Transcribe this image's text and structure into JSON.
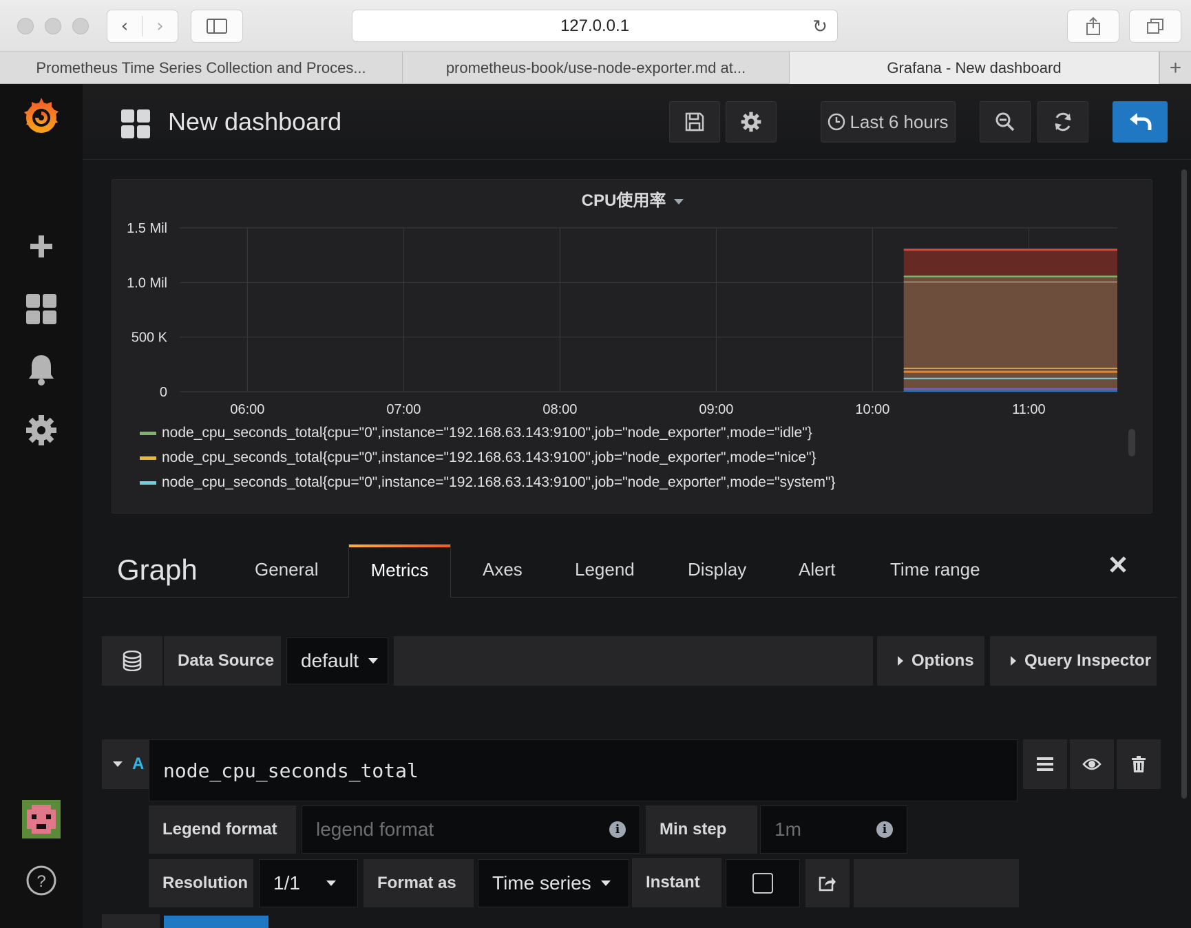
{
  "browser": {
    "address": "127.0.0.1",
    "tabs": [
      {
        "title": "Prometheus Time Series Collection and Proces...",
        "active": false
      },
      {
        "title": "prometheus-book/use-node-exporter.md at...",
        "active": false
      },
      {
        "title": "Grafana - New dashboard",
        "active": true
      }
    ]
  },
  "navbar": {
    "title": "New dashboard",
    "time_picker": "Last 6 hours",
    "accent": "#1f78c1"
  },
  "panel": {
    "title": "CPU使用率",
    "legend": [
      {
        "text": "node_cpu_seconds_total{cpu=\"0\",instance=\"192.168.63.143:9100\",job=\"node_exporter\",mode=\"idle\"}",
        "color": "#7eb26d"
      },
      {
        "text": "node_cpu_seconds_total{cpu=\"0\",instance=\"192.168.63.143:9100\",job=\"node_exporter\",mode=\"nice\"}",
        "color": "#eab839"
      },
      {
        "text": "node_cpu_seconds_total{cpu=\"0\",instance=\"192.168.63.143:9100\",job=\"node_exporter\",mode=\"system\"}",
        "color": "#6ed0e0"
      }
    ]
  },
  "chart_data": {
    "type": "area",
    "title": "CPU使用率",
    "y_ticks": [
      "1.5 Mil",
      "1.0 Mil",
      "500 K",
      "0"
    ],
    "x_ticks": [
      "06:00",
      "07:00",
      "08:00",
      "09:00",
      "10:00",
      "11:00"
    ],
    "ylim": [
      0,
      1500000
    ],
    "x_range": [
      "05:34",
      "11:34"
    ],
    "data_start": "10:12",
    "stacked": true,
    "series": [
      {
        "name": "mode=\"idle\"",
        "color": "#7eb26d",
        "values": [
          1050000,
          1055000,
          1060000
        ]
      },
      {
        "name": "mode=\"nice\"",
        "color": "#eab839",
        "values": [
          180000,
          182000,
          185000
        ]
      },
      {
        "name": "mode=\"system\"",
        "color": "#6ed0e0",
        "values": [
          120000,
          121000,
          122000
        ]
      }
    ],
    "top_level_value": 1300000,
    "grid": true
  },
  "editor": {
    "panel_type": "Graph",
    "tabs": [
      "General",
      "Metrics",
      "Axes",
      "Legend",
      "Display",
      "Alert",
      "Time range"
    ],
    "active_tab": "Metrics",
    "datasource_label": "Data Source",
    "datasource_value": "default",
    "options_label": "Options",
    "query_inspector_label": "Query Inspector",
    "query": {
      "ref_id": "A",
      "expr": "node_cpu_seconds_total",
      "legend_format_label": "Legend format",
      "legend_format_placeholder": "legend format",
      "min_step_label": "Min step",
      "min_step_placeholder": "1m",
      "resolution_label": "Resolution",
      "resolution_value": "1/1",
      "format_as_label": "Format as",
      "format_as_value": "Time series",
      "instant_label": "Instant"
    }
  }
}
